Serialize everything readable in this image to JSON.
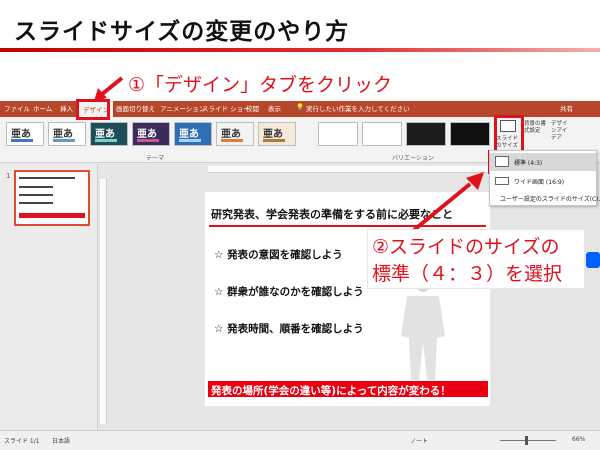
{
  "page": {
    "title": "スライドサイズの変更のやり方",
    "step1": "①「デザイン」タブをクリック",
    "step2_line1": "②スライドのサイズの",
    "step2_line2": "標準（４：３）を選択"
  },
  "ribbon": {
    "tabs": [
      "ファイル",
      "ホーム",
      "挿入",
      "デザイン",
      "画面切り替え",
      "アニメーション",
      "スライド ショー",
      "校閲",
      "表示"
    ],
    "active_tab": "デザイン",
    "help_search": "実行したい作業を入力してください",
    "share": "共有",
    "theme_sample": "亜あ",
    "group_theme": "テーマ",
    "group_variation": "バリエーション",
    "slide_size": "スライドのサイズ",
    "format_background": "背景の書式設定",
    "design_ideas": "デザインアイデア"
  },
  "slide_size_menu": {
    "items": [
      "標準 (4:3)",
      "ワイド画面 (16:9)",
      "ユーザー設定のスライドのサイズ(C)..."
    ],
    "selected": "標準 (4:3)"
  },
  "thumbnails": {
    "slide_number": "1"
  },
  "slide": {
    "title": "研究発表、学会発表の準備をする前に必要なこと",
    "bullets": [
      "☆ 発表の意図を確認しよう",
      "☆ 群衆が誰なのかを確認しよう",
      "☆ 発表時間、順番を確認しよう"
    ],
    "banner": "発表の場所(学会の違い等)によって内容が変わる！"
  },
  "status_bar": {
    "slide_info": "スライド 1/1",
    "language": "日本語",
    "notes": "ノート",
    "zoom": "66%"
  },
  "colors": {
    "accent_red": "#e0101c",
    "ribbon": "#b7472a"
  }
}
